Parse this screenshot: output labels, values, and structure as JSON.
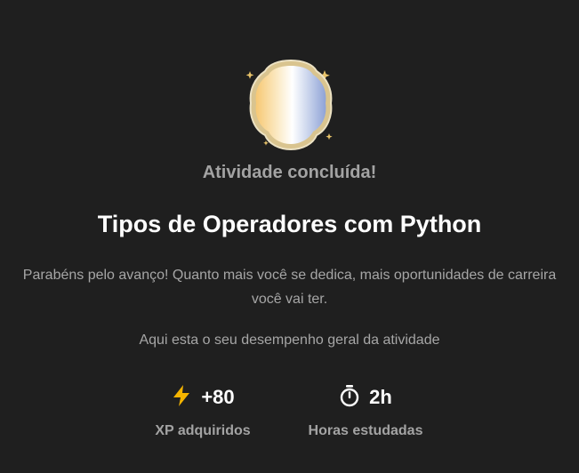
{
  "completion": {
    "status_label": "Atividade concluída!",
    "activity_title": "Tipos de Operadores com Python",
    "congrats_message": "Parabéns pelo avanço! Quanto mais você se dedica, mais oportunidades de carreira você vai ter.",
    "summary_intro": "Aqui esta o seu desempenho geral da atividade"
  },
  "stats": {
    "xp": {
      "icon": "lightning-icon",
      "value": "+80",
      "label": "XP adquiridos"
    },
    "hours": {
      "icon": "stopwatch-icon",
      "value": "2h",
      "label": "Horas estudadas"
    }
  },
  "colors": {
    "background": "#1f1f1f",
    "accent_xp": "#f5b400",
    "muted_text": "#a6a6a6"
  }
}
